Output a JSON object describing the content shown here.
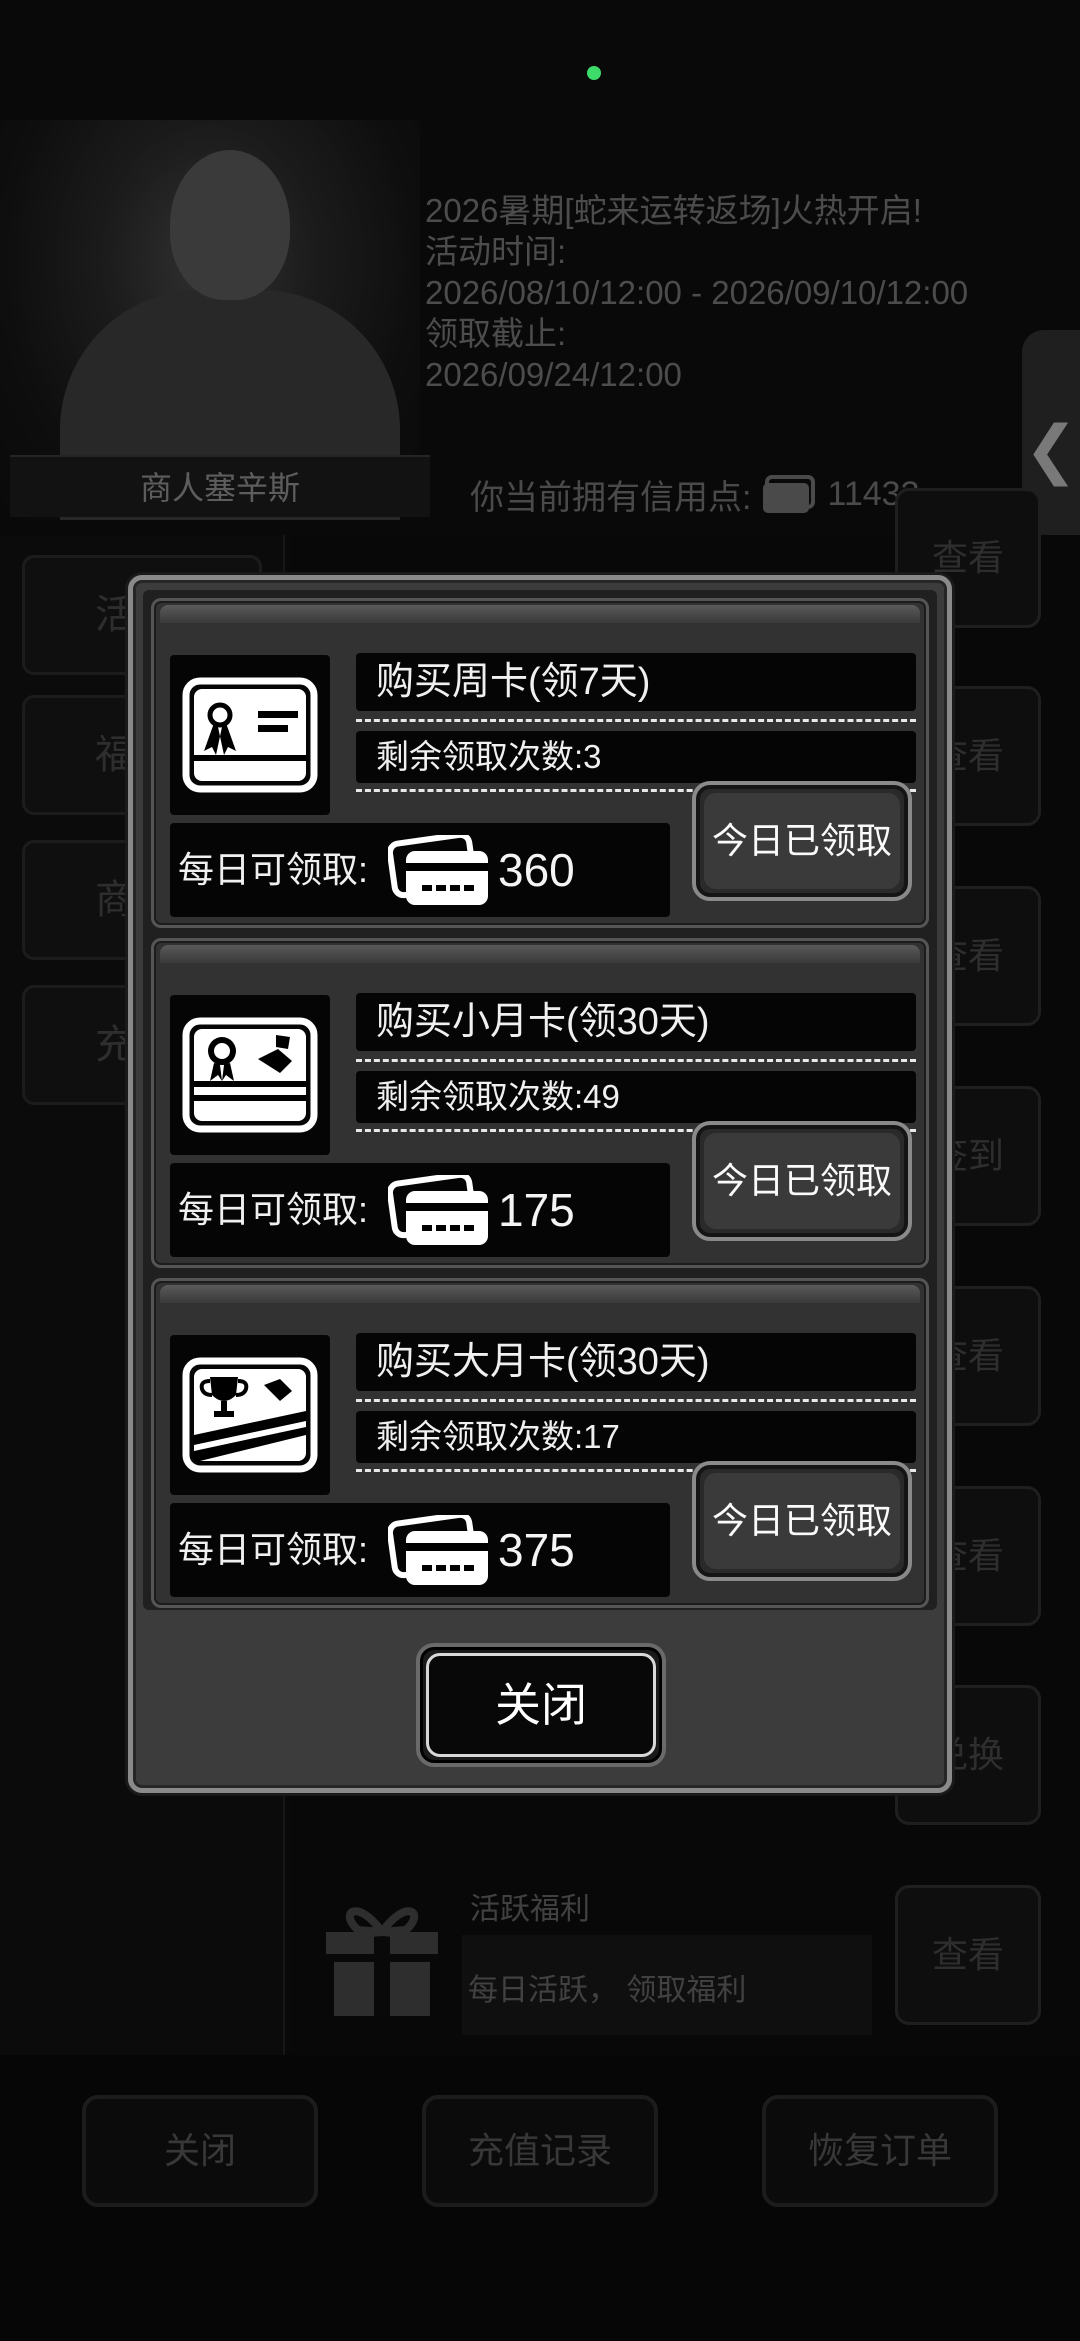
{
  "background": {
    "merchant_name": "商人塞辛斯",
    "announcement": {
      "line1": "2026暑期[蛇来运转返场]火热开启!",
      "line2": "活动时间:",
      "line3": "2026/08/10/12:00 - 2026/09/10/12:00",
      "line4": "领取截止:",
      "line5": "2026/09/24/12:00"
    },
    "credits_label": "你当前拥有信用点:",
    "credits_value": "11433",
    "side_tab_glyph": "❮",
    "left_tabs": [
      "活",
      "福",
      "商",
      "充"
    ],
    "row_buttons": [
      "查看",
      "查看",
      "查看",
      "签到",
      "查看",
      "查看",
      "兑换",
      "查看"
    ],
    "active_item": {
      "title": "活跃福利",
      "desc": "每日活跃， 领取福利"
    },
    "bottom_buttons": [
      "关闭",
      "充值记录",
      "恢复订单"
    ]
  },
  "dialog": {
    "cards": [
      {
        "title": "购买周卡(领7天)",
        "remaining": "剩余领取次数:3",
        "daily_label": "每日可领取:",
        "daily_value": "360",
        "button": "今日已领取",
        "icon": "weekly-card-ribbon-icon"
      },
      {
        "title": "购买小月卡(领30天)",
        "remaining": "剩余领取次数:49",
        "daily_label": "每日可领取:",
        "daily_value": "175",
        "button": "今日已领取",
        "icon": "small-month-card-medal-icon"
      },
      {
        "title": "购买大月卡(领30天)",
        "remaining": "剩余领取次数:17",
        "daily_label": "每日可领取:",
        "daily_value": "375",
        "button": "今日已领取",
        "icon": "big-month-card-trophy-icon"
      }
    ],
    "close_label": "关闭"
  },
  "colors": {
    "status_dot": "#3ddc6a",
    "dialog_frame": "#8a8a8a",
    "panel_dark": "#050505"
  }
}
